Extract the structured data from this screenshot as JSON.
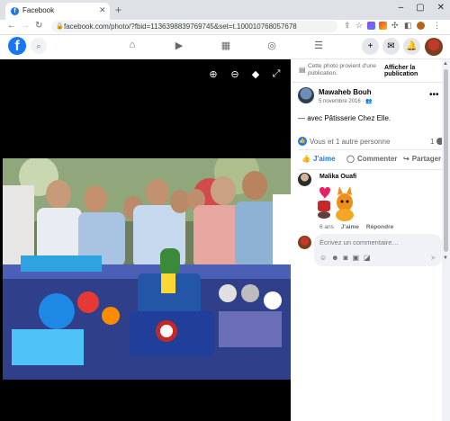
{
  "browser": {
    "tab_title": "Facebook",
    "tab_close": "✕",
    "new_tab": "+",
    "win": {
      "minimize": "–",
      "maximize": "▢",
      "close": "✕"
    },
    "url": "facebook.com/photo/?fbid=1136398839769745&set=t.100010768057678",
    "nav": {
      "back": "←",
      "forward": "→",
      "reload": "↻"
    }
  },
  "fb_header": {
    "logo": "f",
    "search_icon": "search-icon",
    "nav_icons": [
      "home-icon",
      "watch-icon",
      "marketplace-icon",
      "groups-icon",
      "menu-icon"
    ],
    "right_icons": [
      "create-icon",
      "messenger-icon",
      "notifications-icon"
    ]
  },
  "viewer": {
    "tools": [
      "zoom-in-icon",
      "zoom-out-icon",
      "tag-icon",
      "fullscreen-icon"
    ]
  },
  "panel": {
    "notice_text": "Cette photo provient d'une publication.",
    "notice_button": "Afficher la publication",
    "author": "Mawaheb Bouh",
    "date": "5 novembre 2016 · 👥",
    "with_text_prefix": "— avec ",
    "with_name": "Pâtisserie Chez Elle",
    "with_text_suffix": ".",
    "reactions_text": "Vous et 1 autre personne",
    "comment_count": "1",
    "actions": {
      "like": "J'aime",
      "comment": "Commenter",
      "share": "Partager"
    },
    "comment": {
      "author": "Malika Ouafi",
      "age": "6 ans",
      "like": "J'aime",
      "reply": "Répondre"
    },
    "comment_placeholder": "Écrivez un commentaire…"
  },
  "colors": {
    "brand": "#1877f2",
    "viewer_bg": "#000000",
    "chrome": "#dee1e6"
  }
}
